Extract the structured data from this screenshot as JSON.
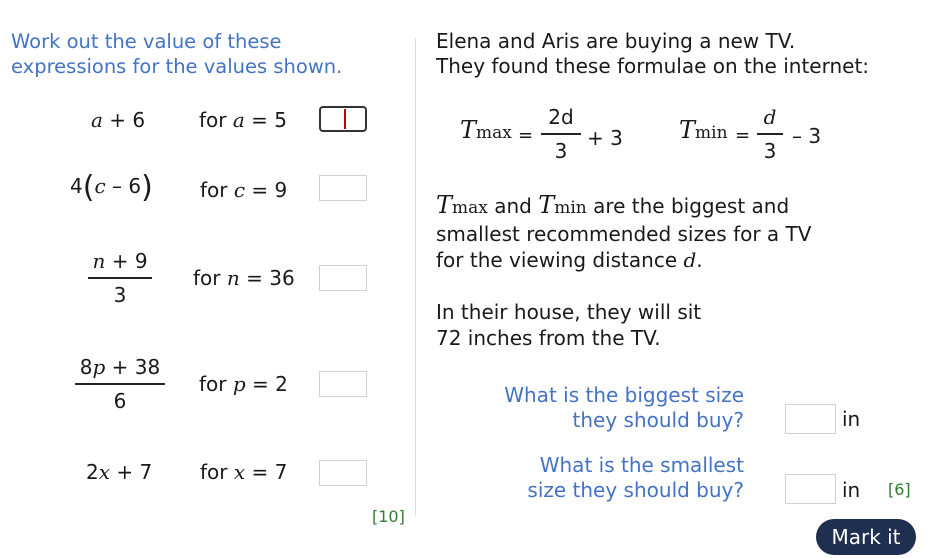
{
  "left": {
    "instruction_line1": "Work out the value of these",
    "instruction_line2": "expressions for the values shown.",
    "q1": {
      "expr_a": "a",
      "expr_rest": " + 6",
      "for_word": "for ",
      "var": "a",
      "value": " = 5",
      "answer": ""
    },
    "q2": {
      "coef": "4",
      "lparen": "(",
      "var_inner": "c",
      "minus": " – 6",
      "rparen": ")",
      "for_word": "for ",
      "var": "c",
      "value": " = 9",
      "answer": ""
    },
    "q3": {
      "num_var": "n",
      "num_rest": " + 9",
      "den": "3",
      "for_word": "for ",
      "var": "n",
      "value": " = 36",
      "answer": ""
    },
    "q4": {
      "num_coef": "8",
      "num_var": "p",
      "num_rest": " + 38",
      "den": "6",
      "for_word": "for ",
      "var": "p",
      "value": " = 2",
      "answer": ""
    },
    "q5": {
      "coef": "2",
      "var_inner": "x",
      "rest": " + 7",
      "for_word": "for ",
      "var": "x",
      "value": " = 7",
      "answer": ""
    },
    "marks": "[10]"
  },
  "right": {
    "intro_line1": "Elena and Aris are buying a new TV.",
    "intro_line2": "They found these formulae on the internet:",
    "formula_max": {
      "T": "T",
      "sub": "max",
      "eq": "=",
      "num": "2d",
      "den": "3",
      "rest": "+ 3"
    },
    "formula_min": {
      "T": "T",
      "sub": "min",
      "eq": "=",
      "num": "d",
      "den": "3",
      "rest": "– 3"
    },
    "desc_T1": "T",
    "desc_sub1": "max",
    "desc_and": " and ",
    "desc_T2": "T",
    "desc_sub2": "min",
    "desc_rest1": " are the biggest and",
    "desc_line2": "smallest recommended sizes for a TV",
    "desc_line3_pre": "for the viewing distance ",
    "desc_line3_var": "d",
    "desc_line3_post": ".",
    "house_line1": "In their house, they will sit",
    "house_line2": "72 inches from the TV.",
    "question1_line1": "What is the biggest size",
    "question1_line2": "they should buy?",
    "question2_line1": "What is the smallest",
    "question2_line2": "size they should buy?",
    "unit": "in",
    "answer1": "",
    "answer2": "",
    "marks": "[6]"
  },
  "mark_button_label": "Mark it",
  "colors": {
    "prompt_blue": "#4472c4",
    "marks_green": "#2e7d32",
    "button_navy": "#1e2f4f",
    "caret_red": "#c00000"
  }
}
